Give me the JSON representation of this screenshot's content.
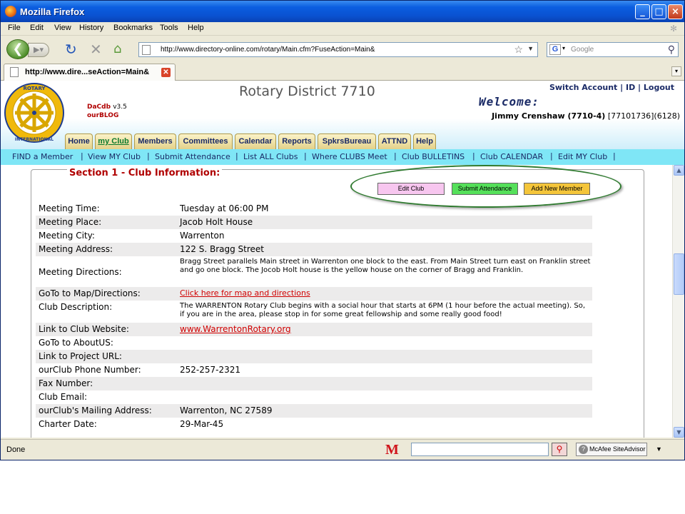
{
  "window": {
    "title": "Mozilla Firefox",
    "minimize": "_",
    "maximize": "□",
    "close": "×"
  },
  "menu": [
    "File",
    "Edit",
    "View",
    "History",
    "Bookmarks",
    "Tools",
    "Help"
  ],
  "toolbar": {
    "url": "http://www.directory-online.com/rotary/Main.cfm?FuseAction=Main&",
    "search_placeholder": "Google",
    "search_engine": "G"
  },
  "tab": {
    "title": "http://www.dire...seAction=Main&"
  },
  "site": {
    "dacdb_name": "DaCdb",
    "dacdb_version": "v3.5",
    "blog": "ourBLOG",
    "district": "Rotary District 7710",
    "account_links": [
      "Switch Account",
      "ID",
      "Logout"
    ],
    "welcome": "Welcome:",
    "user_name": "Jimmy Crenshaw (7710-4)",
    "user_ids": " [77101736](6128)",
    "logo_text_top": "ROTARY",
    "logo_text_bottom": "INTERNATIONAL"
  },
  "club_tabs": [
    "Home",
    "my Club",
    "Members",
    "Committees",
    "Calendar",
    "Reports",
    "SpkrsBureau",
    "ATTND",
    "Help"
  ],
  "active_club_tab": "my Club",
  "link_bar": [
    "FIND a Member",
    "View MY Club",
    "Submit Attendance",
    "List ALL Clubs",
    "Where CLUBS Meet",
    "Club BULLETINS",
    "Club CALENDAR",
    "Edit MY Club"
  ],
  "section": {
    "title": "Section 1 - Club Information:",
    "buttons": {
      "edit_club": "Edit Club",
      "submit_attendance": "Submit Attendance",
      "add_new_member": "Add New Member"
    },
    "rows": [
      {
        "label": "Meeting Time:",
        "value": "Tuesday at 06:00 PM"
      },
      {
        "label": "Meeting Place:",
        "value": "Jacob Holt House"
      },
      {
        "label": "Meeting City:",
        "value": "Warrenton"
      },
      {
        "label": "Meeting Address:",
        "value": "122 S. Bragg Street"
      },
      {
        "label": "Meeting Directions:",
        "value": "Bragg Street parallels Main street in Warrenton one block to the east. From Main Street turn east on Franklin street and go one block. The Jocob Holt house is the yellow house on the corner of Bragg and Franklin."
      },
      {
        "label": "GoTo to Map/Directions:",
        "value": "Click here for map and directions"
      },
      {
        "label": "Club Description:",
        "value": "The WARRENTON Rotary Club begins with a social hour that starts at 6PM (1 hour before the actual meeting). So, if you are in the area, please stop in for some great fellowship and some really good food!"
      },
      {
        "label": "Link to Club Website:",
        "value": "www.WarrentonRotary.org"
      },
      {
        "label": "GoTo to AboutUS:",
        "value": ""
      },
      {
        "label": "Link to Project URL:",
        "value": ""
      },
      {
        "label": "ourClub Phone Number:",
        "value": "252-257-2321"
      },
      {
        "label": "Fax Number:",
        "value": ""
      },
      {
        "label": "Club Email:",
        "value": ""
      },
      {
        "label": "ourClub's Mailing Address:",
        "value": "Warrenton, NC  27589"
      },
      {
        "label": "Charter Date:",
        "value": "29-Mar-45"
      }
    ]
  },
  "status": {
    "text": "Done",
    "mcafee": "McAfee SiteAdvisor"
  },
  "colors": {
    "title_bar": "#0a52d1",
    "link_bar": "#7fe6f6",
    "section_title": "#b00000",
    "oval": "#2f7a2f",
    "edit_club_btn": "#f7c6ef",
    "submit_attendance_btn": "#55e05a",
    "add_member_btn": "#f4c53a"
  }
}
